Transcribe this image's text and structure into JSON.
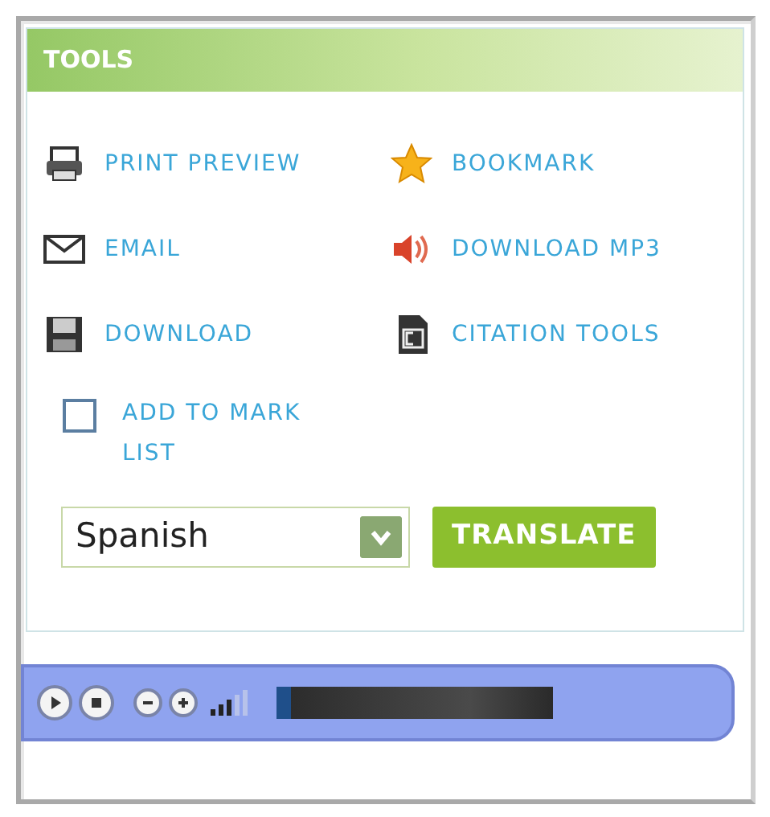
{
  "panel": {
    "title": "TOOLS"
  },
  "tools": [
    {
      "label": "PRINT PREVIEW",
      "kind": "print"
    },
    {
      "label": "BOOKMARK",
      "kind": "bookmark"
    },
    {
      "label": "EMAIL",
      "kind": "email"
    },
    {
      "label": "DOWNLOAD MP3",
      "kind": "audio"
    },
    {
      "label": "DOWNLOAD",
      "kind": "download"
    },
    {
      "label": "CITATION TOOLS",
      "kind": "citation"
    }
  ],
  "mark_list": {
    "label": "ADD TO MARK LIST",
    "checked": false
  },
  "translate": {
    "language": "Spanish",
    "button": "TRANSLATE"
  },
  "player": {
    "volume": {
      "level": 0.6
    },
    "progress": {
      "level": 0.05
    }
  }
}
